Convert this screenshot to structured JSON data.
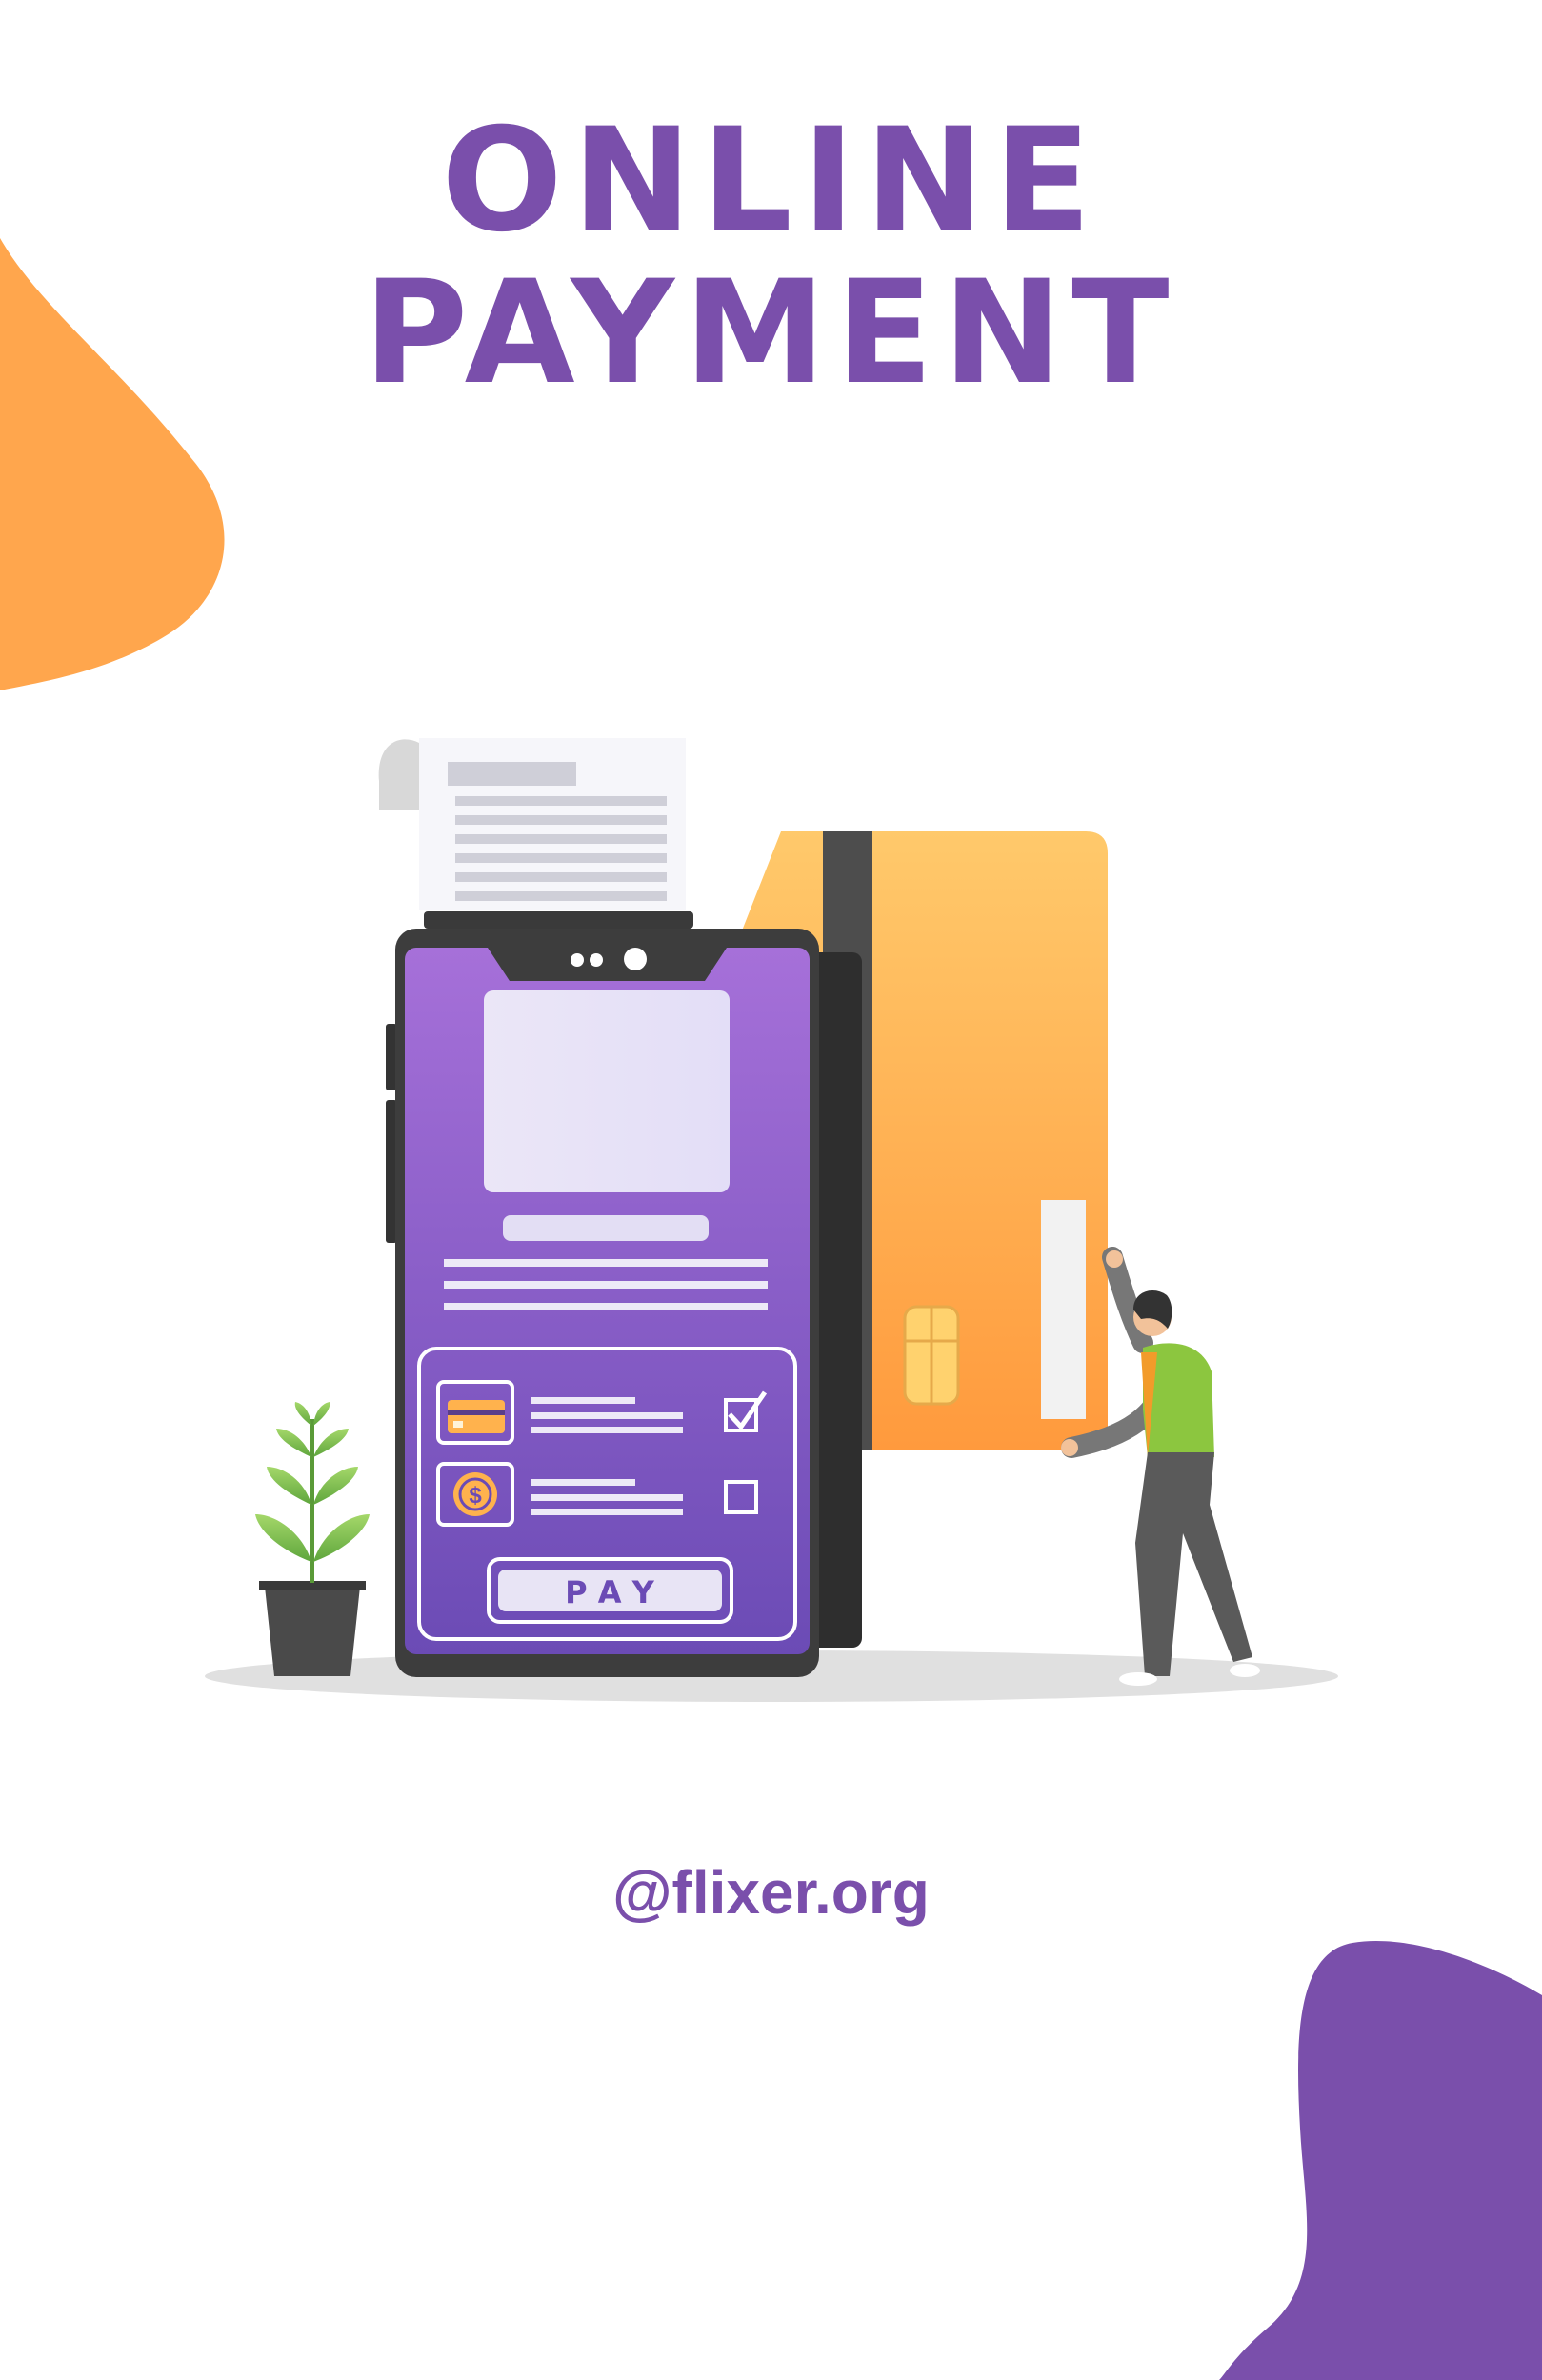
{
  "title": {
    "line1": "ONLINE",
    "line2": "PAYMENT"
  },
  "pay_button": {
    "label": "P A Y"
  },
  "handle": "@flixer.org",
  "colors": {
    "brand_purple": "#7a4fab",
    "accent_orange": "#ffa64d",
    "card_orange": "#ffb24d",
    "phone_dark": "#3d3d3d"
  },
  "icons": [
    "credit-card-icon",
    "dollar-coin-icon",
    "checkbox-checked-icon",
    "checkbox-empty-icon",
    "receipt-icon",
    "plant-icon",
    "person-icon"
  ]
}
